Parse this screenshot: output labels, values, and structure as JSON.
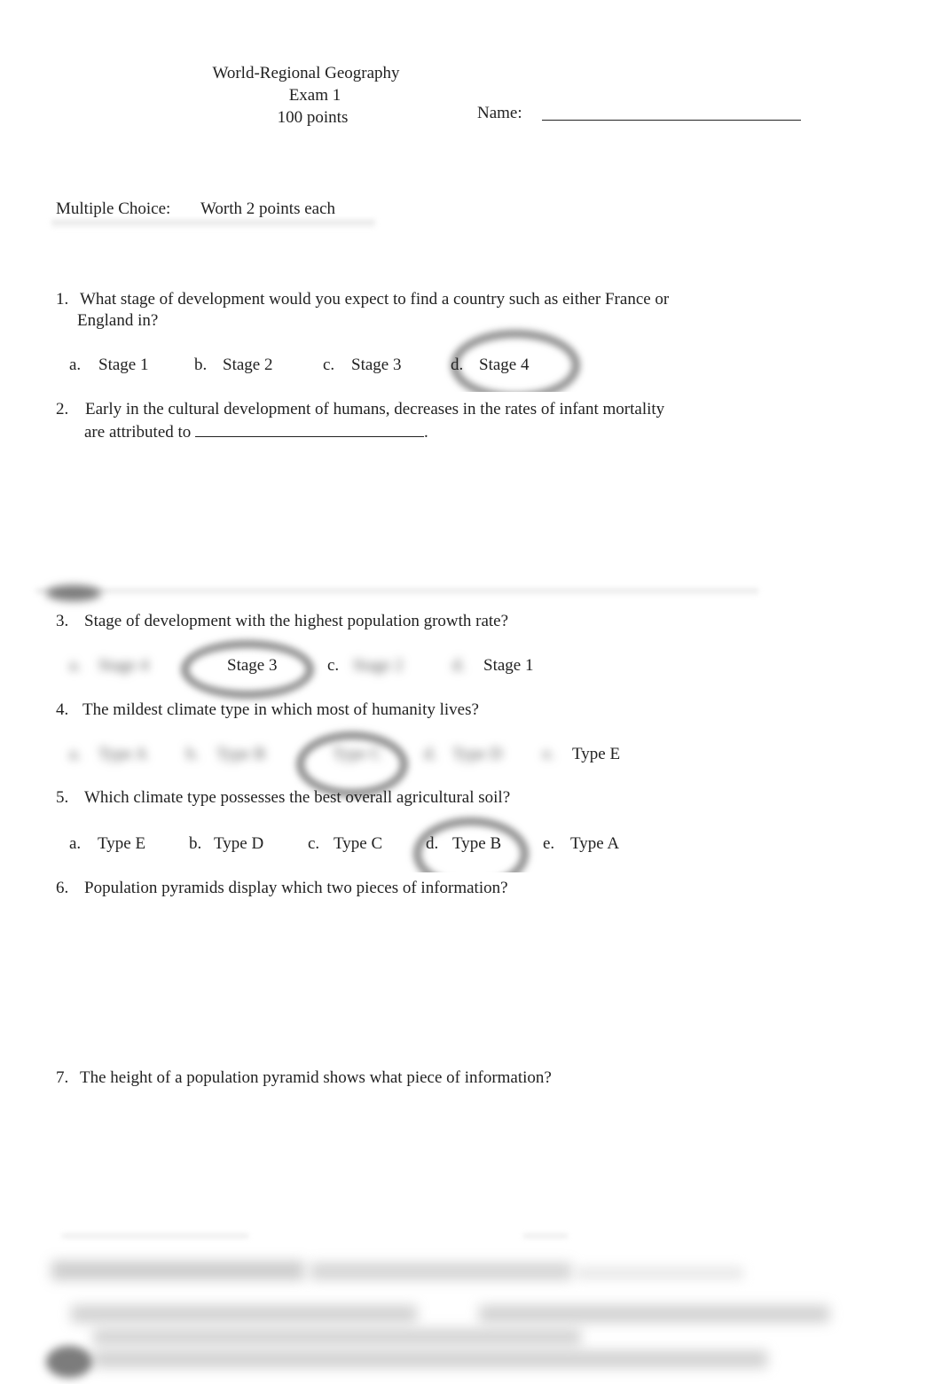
{
  "header": {
    "course_title": "World-Regional Geography",
    "exam_title": "Exam 1",
    "points": "100 points",
    "name_label": "Name:"
  },
  "section": {
    "label": "Multiple Choice:",
    "worth": "Worth 2 points each"
  },
  "questions": [
    {
      "number": "1.",
      "text_line1": "What stage of development would you expect to find a country such as either France or",
      "text_line2": "England in?",
      "options": [
        {
          "letter": "a.",
          "label": "Stage 1"
        },
        {
          "letter": "b.",
          "label": "Stage 2"
        },
        {
          "letter": "c.",
          "label": "Stage 3"
        },
        {
          "letter": "d.",
          "label": "Stage 4",
          "circled": true
        }
      ]
    },
    {
      "number": "2.",
      "text_line1": "Early in the cultural development of humans, decreases in the rates of infant mortality",
      "text_line2": "are attributed to",
      "text_end": "."
    },
    {
      "number": "3.",
      "text": "Stage of development with the highest population growth rate?",
      "options": [
        {
          "letter": "a.",
          "label": "Stage 4",
          "blurred": true
        },
        {
          "letter": "",
          "label": "Stage 3",
          "circled": true
        },
        {
          "letter": "c.",
          "label": "Stage 2",
          "blurred_label": true
        },
        {
          "letter": "d.",
          "label": "Stage 1",
          "blurred_letter": true
        }
      ]
    },
    {
      "number": "4.",
      "text": "The mildest climate type in which most of humanity lives?",
      "options": [
        {
          "letter": "a.",
          "label": "Type A",
          "blurred": true
        },
        {
          "letter": "b.",
          "label": "Type B",
          "blurred": true
        },
        {
          "letter": "c.",
          "label": "Type C",
          "blurred": true,
          "circled": true
        },
        {
          "letter": "d.",
          "label": "Type D",
          "blurred": true
        },
        {
          "letter": "e.",
          "label": "Type E",
          "blurred_letter": true
        }
      ]
    },
    {
      "number": "5.",
      "text": "Which climate type possesses the best overall agricultural soil?",
      "options": [
        {
          "letter": "a.",
          "label": "Type E"
        },
        {
          "letter": "b.",
          "label": "Type D"
        },
        {
          "letter": "c.",
          "label": "Type C"
        },
        {
          "letter": "d.",
          "label": "Type B",
          "circled": true
        },
        {
          "letter": "e.",
          "label": "Type A"
        }
      ]
    },
    {
      "number": "6.",
      "text": "Population pyramids display which two pieces of information?"
    },
    {
      "number": "7.",
      "text": "The height of a population pyramid shows what piece of information?"
    }
  ],
  "redacted": {
    "q8_visible": false
  }
}
